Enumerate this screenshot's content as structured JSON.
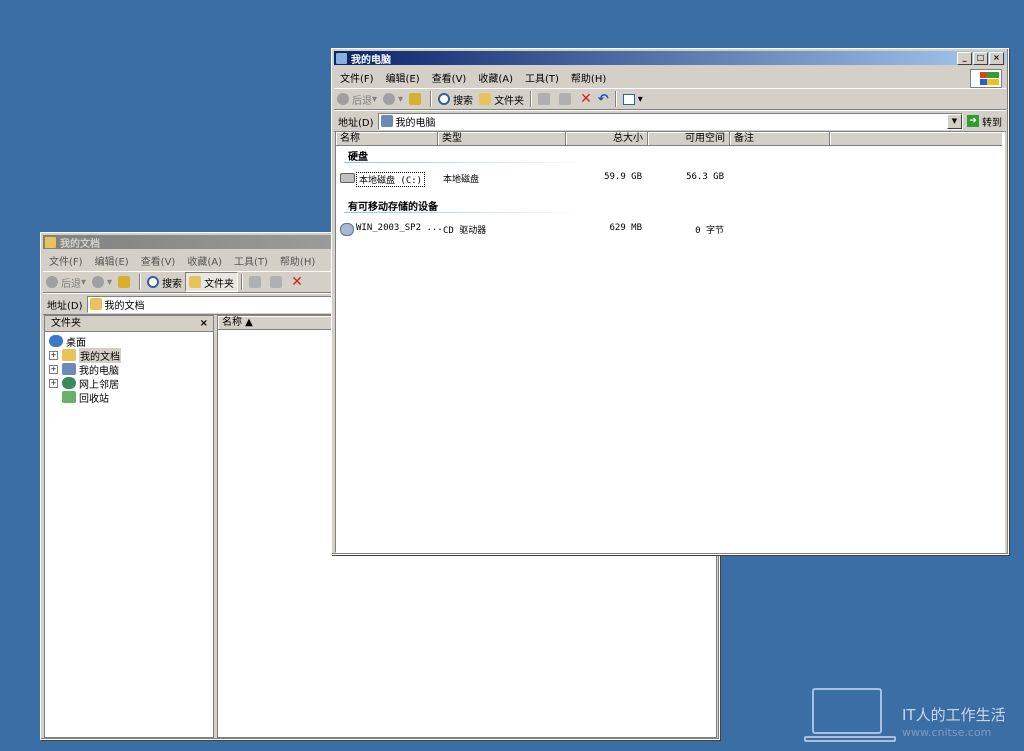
{
  "colors": {
    "desktop": "#3a6ea5",
    "title_active": "#0a246a",
    "title_inactive": "#808080"
  },
  "back_window": {
    "title": "我的文档",
    "menu": [
      "文件(F)",
      "编辑(E)",
      "查看(V)",
      "收藏(A)",
      "工具(T)",
      "帮助(H)"
    ],
    "toolbar": {
      "back": "后退",
      "search": "搜索",
      "folders": "文件夹"
    },
    "address_label": "地址(D)",
    "address_value": "我的文档",
    "pane_title": "文件夹",
    "pane_close": "×",
    "tree": [
      {
        "label": "桌面",
        "icon": "desktop-icon"
      },
      {
        "label": "我的文档",
        "icon": "my-documents-icon"
      },
      {
        "label": "我的电脑",
        "icon": "my-computer-icon"
      },
      {
        "label": "网上邻居",
        "icon": "network-icon"
      },
      {
        "label": "回收站",
        "icon": "recycle-bin-icon"
      }
    ],
    "col_name": "名称 ▲"
  },
  "front_window": {
    "title": "我的电脑",
    "menu": [
      "文件(F)",
      "编辑(E)",
      "查看(V)",
      "收藏(A)",
      "工具(T)",
      "帮助(H)"
    ],
    "toolbar": {
      "back": "后退",
      "search": "搜索",
      "folders": "文件夹"
    },
    "address_label": "地址(D)",
    "address_value": "我的电脑",
    "go_label": "转到",
    "columns": [
      "名称",
      "类型",
      "总大小",
      "可用空间",
      "备注"
    ],
    "groups": [
      {
        "title": "硬盘",
        "items": [
          {
            "name": "本地磁盘 (C:)",
            "type": "本地磁盘",
            "total": "59.9 GB",
            "free": "56.3 GB",
            "icon": "hard-disk-icon"
          }
        ]
      },
      {
        "title": "有可移动存储的设备",
        "items": [
          {
            "name": "WIN_2003_SP2 ...",
            "type": "CD 驱动器",
            "total": "629 MB",
            "free": "0 字节",
            "icon": "cd-drive-icon"
          }
        ]
      }
    ]
  },
  "watermark": {
    "text": "IT人的工作生活",
    "url": "www.cnitse.com"
  }
}
